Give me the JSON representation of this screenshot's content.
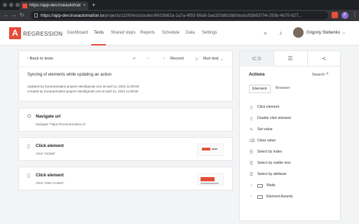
{
  "browser": {
    "tab_title": "https://app-dev.trueautomation.io...",
    "tab_close": "×",
    "new_tab": "+",
    "url_host": "https://app-dev.trueautomation.io",
    "url_path": "/projects/1100/tests/suites/6619b62a-1a7a-4f93-99a8-3aa320d818b0/tests/93b63704-293b-4b70-827..."
  },
  "header": {
    "logo_letter": "A",
    "brand": "REGRESSION",
    "nav": [
      "Dashboard",
      "Tests",
      "Shared steps",
      "Reports",
      "Schedule",
      "Data",
      "Settings"
    ],
    "active_nav": "Tests",
    "user_name": "Grigoriy Stebenko",
    "accent": "#e54c38"
  },
  "test": {
    "back_label": "Back to tests",
    "record_label": "Record",
    "run_label": "Run test",
    "title": "Syncing of elements while updating an action",
    "updated_by": "Updated by trueautomation.project+dev@gmail.com at April 11, 2022 11:09:05",
    "created_by": "Created by trueautomation.project+dev@gmail.com at April 11, 2022 11:09:05"
  },
  "steps": [
    {
      "title": "Navigate url",
      "sub": "Navigate \"https://trueautomation.io\""
    },
    {
      "title": "Click element",
      "sub": "Click \"HOME\""
    },
    {
      "title": "Click element",
      "sub": "Click \"USE CASES\""
    }
  ],
  "panel": {
    "actions_title": "Actions",
    "search_label": "Search",
    "subtab_element": "Element",
    "subtab_browser": "Browser",
    "actions": [
      "Click element",
      "Double click element",
      "Set value",
      "Clear value",
      "Select by index",
      "Select by visible text",
      "Select by attribute"
    ],
    "folders": [
      "Waits",
      "Element Asserts"
    ]
  }
}
